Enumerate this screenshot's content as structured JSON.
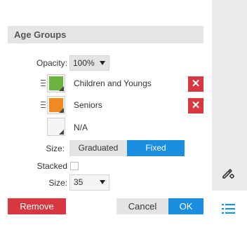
{
  "section": {
    "title": "Age Groups"
  },
  "opacity": {
    "label": "Opacity:",
    "value": "100%"
  },
  "items": [
    {
      "label": "Children and Youngs",
      "color": "#6db33f"
    },
    {
      "label": "Seniors",
      "color": "#ef8a22"
    },
    {
      "label": "N/A",
      "color": "#f4f4f4"
    }
  ],
  "size_mode": {
    "label": "Size:",
    "options": [
      "Graduated",
      "Fixed"
    ],
    "selected": "Fixed"
  },
  "stacked": {
    "label": "Stacked",
    "checked": false
  },
  "size": {
    "label": "Size:",
    "value": "35"
  },
  "buttons": {
    "remove": "Remove",
    "cancel": "Cancel",
    "ok": "OK"
  },
  "colors": {
    "accent": "#1a8ee1",
    "danger": "#d9373f",
    "segment_inactive": "#e4e4e4",
    "rail": "#ebebeb"
  },
  "icons": {
    "edit": "pencil-gear-icon",
    "list": "list-icon",
    "delete": "close-icon",
    "drag": "drag-handle-icon"
  }
}
